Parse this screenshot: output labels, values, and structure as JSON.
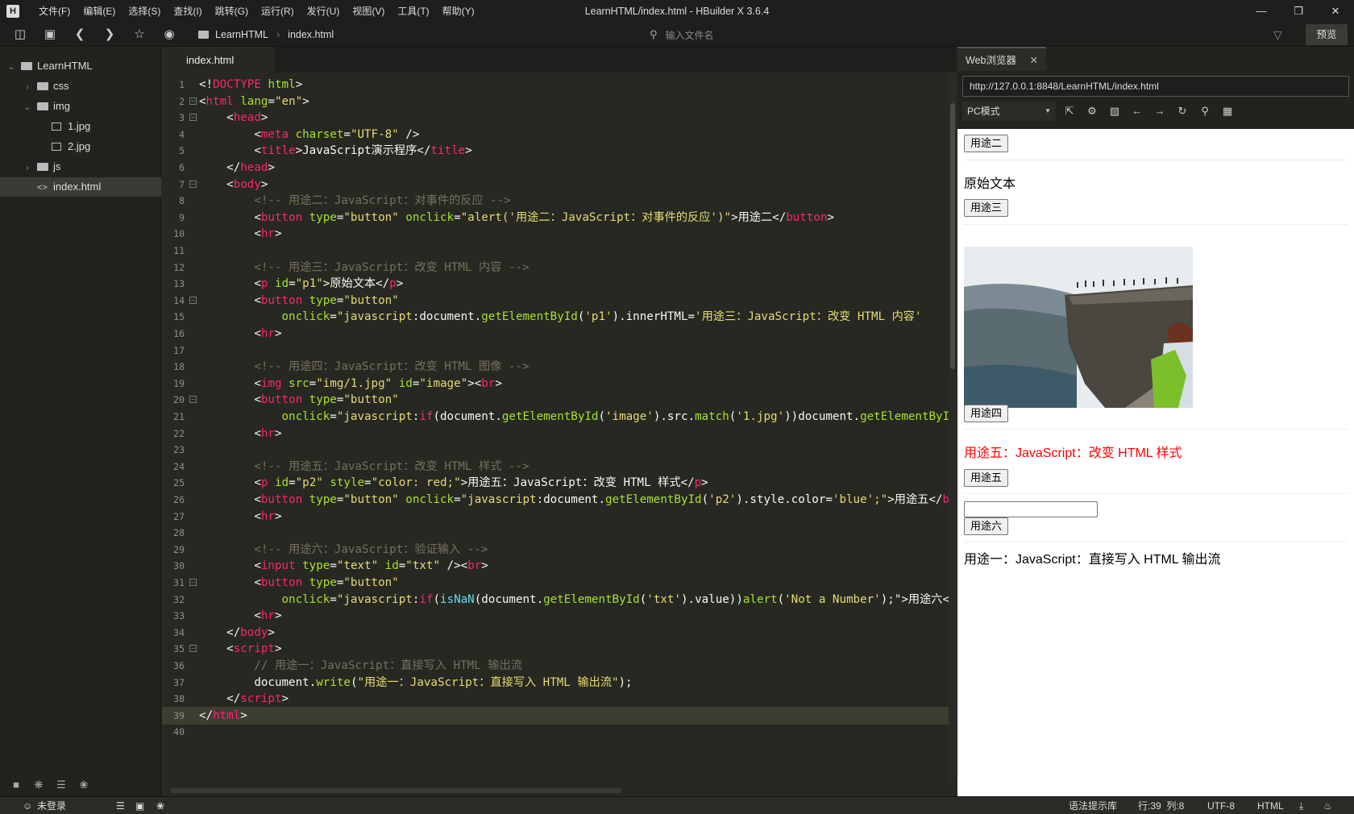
{
  "window": {
    "title": "LearnHTML/index.html - HBuilder X 3.6.4",
    "logo": "H"
  },
  "menu": [
    "文件(F)",
    "编辑(E)",
    "选择(S)",
    "查找(I)",
    "跳转(G)",
    "运行(R)",
    "发行(U)",
    "视图(V)",
    "工具(T)",
    "帮助(Y)"
  ],
  "toolbar": {
    "breadcrumb": [
      "LearnHTML",
      "index.html"
    ],
    "file_search_placeholder": "输入文件名",
    "preview_label": "预览"
  },
  "explorer": {
    "items": [
      {
        "label": "LearnHTML",
        "type": "folder",
        "expanded": true
      },
      {
        "label": "css",
        "type": "folder",
        "expanded": false
      },
      {
        "label": "img",
        "type": "folder",
        "expanded": true
      },
      {
        "label": "1.jpg",
        "type": "image"
      },
      {
        "label": "2.jpg",
        "type": "image"
      },
      {
        "label": "js",
        "type": "folder",
        "expanded": false
      },
      {
        "label": "index.html",
        "type": "html",
        "selected": true
      }
    ]
  },
  "editor": {
    "tab": "index.html",
    "cursor_line": 39,
    "lines": [
      [
        [
          "w",
          "<!"
        ],
        [
          "t",
          "DOCTYPE"
        ],
        [
          "w",
          " "
        ],
        [
          "a",
          "html"
        ],
        [
          "w",
          ">"
        ]
      ],
      [
        [
          "w",
          "<"
        ],
        [
          "t",
          "html"
        ],
        [
          "w",
          " "
        ],
        [
          "a",
          "lang"
        ],
        [
          "w",
          "="
        ],
        [
          "s",
          "\"en\""
        ],
        [
          "w",
          ">"
        ]
      ],
      [
        [
          "w",
          "    <"
        ],
        [
          "t",
          "head"
        ],
        [
          "w",
          ">"
        ]
      ],
      [
        [
          "w",
          "        <"
        ],
        [
          "t",
          "meta"
        ],
        [
          "w",
          " "
        ],
        [
          "a",
          "charset"
        ],
        [
          "w",
          "="
        ],
        [
          "s",
          "\"UTF-8\""
        ],
        [
          "w",
          " />"
        ]
      ],
      [
        [
          "w",
          "        <"
        ],
        [
          "t",
          "title"
        ],
        [
          "w",
          ">JavaScript演示程序</"
        ],
        [
          "t",
          "title"
        ],
        [
          "w",
          ">"
        ]
      ],
      [
        [
          "w",
          "    </"
        ],
        [
          "t",
          "head"
        ],
        [
          "w",
          ">"
        ]
      ],
      [
        [
          "w",
          "    <"
        ],
        [
          "t",
          "body"
        ],
        [
          "w",
          ">"
        ]
      ],
      [
        [
          "c",
          "        <!-- 用途二：JavaScript：对事件的反应 -->"
        ]
      ],
      [
        [
          "w",
          "        <"
        ],
        [
          "t",
          "button"
        ],
        [
          "w",
          " "
        ],
        [
          "a",
          "type"
        ],
        [
          "w",
          "="
        ],
        [
          "s",
          "\"button\""
        ],
        [
          "w",
          " "
        ],
        [
          "a",
          "onclick"
        ],
        [
          "w",
          "="
        ],
        [
          "s",
          "\"alert('用途二：JavaScript：对事件的反应')\""
        ],
        [
          "w",
          ">用途二</"
        ],
        [
          "t",
          "button"
        ],
        [
          "w",
          ">"
        ]
      ],
      [
        [
          "w",
          "        <"
        ],
        [
          "t",
          "hr"
        ],
        [
          "w",
          ">"
        ]
      ],
      [
        [
          "w",
          ""
        ]
      ],
      [
        [
          "c",
          "        <!-- 用途三：JavaScript：改变 HTML 内容 -->"
        ]
      ],
      [
        [
          "w",
          "        <"
        ],
        [
          "t",
          "p"
        ],
        [
          "w",
          " "
        ],
        [
          "a",
          "id"
        ],
        [
          "w",
          "="
        ],
        [
          "s",
          "\"p1\""
        ],
        [
          "w",
          ">原始文本</"
        ],
        [
          "t",
          "p"
        ],
        [
          "w",
          ">"
        ]
      ],
      [
        [
          "w",
          "        <"
        ],
        [
          "t",
          "button"
        ],
        [
          "w",
          " "
        ],
        [
          "a",
          "type"
        ],
        [
          "w",
          "="
        ],
        [
          "s",
          "\"button\""
        ]
      ],
      [
        [
          "w",
          "            "
        ],
        [
          "a",
          "onclick"
        ],
        [
          "w",
          "="
        ],
        [
          "s",
          "\"javascript"
        ],
        [
          "w",
          ":document."
        ],
        [
          "a",
          "getElementById"
        ],
        [
          "w",
          "("
        ],
        [
          "s",
          "'p1'"
        ],
        [
          "w",
          ").innerHTML="
        ],
        [
          "s",
          "'用途三：JavaScript：改变 HTML 内容'"
        ]
      ],
      [
        [
          "w",
          "        <"
        ],
        [
          "t",
          "hr"
        ],
        [
          "w",
          ">"
        ]
      ],
      [
        [
          "w",
          ""
        ]
      ],
      [
        [
          "c",
          "        <!-- 用途四：JavaScript：改变 HTML 图像 -->"
        ]
      ],
      [
        [
          "w",
          "        <"
        ],
        [
          "t",
          "img"
        ],
        [
          "w",
          " "
        ],
        [
          "a",
          "src"
        ],
        [
          "w",
          "="
        ],
        [
          "s",
          "\"img/1.jpg\""
        ],
        [
          "w",
          " "
        ],
        [
          "a",
          "id"
        ],
        [
          "w",
          "="
        ],
        [
          "s",
          "\"image\""
        ],
        [
          "w",
          "><"
        ],
        [
          "t",
          "br"
        ],
        [
          "w",
          ">"
        ]
      ],
      [
        [
          "w",
          "        <"
        ],
        [
          "t",
          "button"
        ],
        [
          "w",
          " "
        ],
        [
          "a",
          "type"
        ],
        [
          "w",
          "="
        ],
        [
          "s",
          "\"button\""
        ]
      ],
      [
        [
          "w",
          "            "
        ],
        [
          "a",
          "onclick"
        ],
        [
          "w",
          "="
        ],
        [
          "s",
          "\"javascript"
        ],
        [
          "w",
          ":"
        ],
        [
          "t",
          "if"
        ],
        [
          "w",
          "(document."
        ],
        [
          "a",
          "getElementById"
        ],
        [
          "w",
          "("
        ],
        [
          "s",
          "'image'"
        ],
        [
          "w",
          ").src."
        ],
        [
          "a",
          "match"
        ],
        [
          "w",
          "("
        ],
        [
          "s",
          "'1.jpg'"
        ],
        [
          "w",
          "))document."
        ],
        [
          "a",
          "getElementById"
        ]
      ],
      [
        [
          "w",
          "        <"
        ],
        [
          "t",
          "hr"
        ],
        [
          "w",
          ">"
        ]
      ],
      [
        [
          "w",
          ""
        ]
      ],
      [
        [
          "c",
          "        <!-- 用途五：JavaScript：改变 HTML 样式 -->"
        ]
      ],
      [
        [
          "w",
          "        <"
        ],
        [
          "t",
          "p"
        ],
        [
          "w",
          " "
        ],
        [
          "a",
          "id"
        ],
        [
          "w",
          "="
        ],
        [
          "s",
          "\"p2\""
        ],
        [
          "w",
          " "
        ],
        [
          "a",
          "style"
        ],
        [
          "w",
          "="
        ],
        [
          "s",
          "\"color: red;\""
        ],
        [
          "w",
          ">用途五：JavaScript：改变 HTML 样式</"
        ],
        [
          "t",
          "p"
        ],
        [
          "w",
          ">"
        ]
      ],
      [
        [
          "w",
          "        <"
        ],
        [
          "t",
          "button"
        ],
        [
          "w",
          " "
        ],
        [
          "a",
          "type"
        ],
        [
          "w",
          "="
        ],
        [
          "s",
          "\"button\""
        ],
        [
          "w",
          " "
        ],
        [
          "a",
          "onclick"
        ],
        [
          "w",
          "="
        ],
        [
          "s",
          "\"javascript"
        ],
        [
          "w",
          ":document."
        ],
        [
          "a",
          "getElementById"
        ],
        [
          "w",
          "("
        ],
        [
          "s",
          "'p2'"
        ],
        [
          "w",
          ").style.color="
        ],
        [
          "s",
          "'blue';\""
        ],
        [
          "w",
          ">用途五</"
        ],
        [
          "t",
          "button"
        ],
        [
          "w",
          ">"
        ]
      ],
      [
        [
          "w",
          "        <"
        ],
        [
          "t",
          "hr"
        ],
        [
          "w",
          ">"
        ]
      ],
      [
        [
          "w",
          ""
        ]
      ],
      [
        [
          "c",
          "        <!-- 用途六：JavaScript：验证输入 -->"
        ]
      ],
      [
        [
          "w",
          "        <"
        ],
        [
          "t",
          "input"
        ],
        [
          "w",
          " "
        ],
        [
          "a",
          "type"
        ],
        [
          "w",
          "="
        ],
        [
          "s",
          "\"text\""
        ],
        [
          "w",
          " "
        ],
        [
          "a",
          "id"
        ],
        [
          "w",
          "="
        ],
        [
          "s",
          "\"txt\""
        ],
        [
          "w",
          " /><"
        ],
        [
          "t",
          "br"
        ],
        [
          "w",
          ">"
        ]
      ],
      [
        [
          "w",
          "        <"
        ],
        [
          "t",
          "button"
        ],
        [
          "w",
          " "
        ],
        [
          "a",
          "type"
        ],
        [
          "w",
          "="
        ],
        [
          "s",
          "\"button\""
        ]
      ],
      [
        [
          "w",
          "            "
        ],
        [
          "a",
          "onclick"
        ],
        [
          "w",
          "="
        ],
        [
          "s",
          "\"javascript"
        ],
        [
          "w",
          ":"
        ],
        [
          "t",
          "if"
        ],
        [
          "w",
          "("
        ],
        [
          "f",
          "isNaN"
        ],
        [
          "w",
          "(document."
        ],
        [
          "a",
          "getElementById"
        ],
        [
          "w",
          "("
        ],
        [
          "s",
          "'txt'"
        ],
        [
          "w",
          ").value))"
        ],
        [
          "a",
          "alert"
        ],
        [
          "w",
          "("
        ],
        [
          "s",
          "'Not a Number'"
        ],
        [
          "w",
          ");\">用途六</"
        ],
        [
          "t",
          "button"
        ],
        [
          "w",
          ">"
        ]
      ],
      [
        [
          "w",
          "        <"
        ],
        [
          "t",
          "hr"
        ],
        [
          "w",
          ">"
        ]
      ],
      [
        [
          "w",
          "    </"
        ],
        [
          "t",
          "body"
        ],
        [
          "w",
          ">"
        ]
      ],
      [
        [
          "w",
          "    <"
        ],
        [
          "t",
          "script"
        ],
        [
          "w",
          ">"
        ]
      ],
      [
        [
          "c",
          "        // 用途一：JavaScript：直接写入 HTML 输出流"
        ]
      ],
      [
        [
          "w",
          "        document."
        ],
        [
          "a",
          "write"
        ],
        [
          "w",
          "("
        ],
        [
          "s",
          "\"用途一：JavaScript：直接写入 HTML 输出流\""
        ],
        [
          "w",
          ");"
        ]
      ],
      [
        [
          "w",
          "    </"
        ],
        [
          "t",
          "script"
        ],
        [
          "w",
          ">"
        ]
      ],
      [
        [
          "w",
          "</"
        ],
        [
          "t",
          "html"
        ],
        [
          "w",
          ">"
        ]
      ],
      [
        [
          "w",
          ""
        ]
      ]
    ],
    "folds": [
      2,
      3,
      7,
      14,
      20,
      31,
      35
    ]
  },
  "browser": {
    "tab_label": "Web浏览器",
    "url": "http://127.0.0.1:8848/LearnHTML/index.html",
    "mode": "PC模式",
    "page": {
      "btn2": "用途二",
      "p1": "原始文本",
      "btn3": "用途三",
      "btn4": "用途四",
      "p2": "用途五：JavaScript：改变 HTML 样式",
      "p2_color": "#ff0000",
      "btn5": "用途五",
      "btn6": "用途六",
      "written": "用途一：JavaScript：直接写入 HTML 输出流"
    }
  },
  "status": {
    "login": "未登录",
    "syntax": "语法提示库",
    "position": "行:39  列:8",
    "encoding": "UTF-8",
    "language": "HTML"
  }
}
